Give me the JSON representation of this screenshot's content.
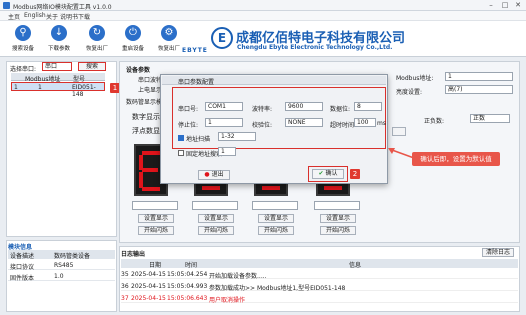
{
  "window": {
    "title": "Modbus网络IO模块配置工具 v1.0.0"
  },
  "menu": [
    "主页",
    "English",
    "关于",
    "说明书下载"
  ],
  "toolbar": {
    "buttons": [
      {
        "label": "搜索设备",
        "icon": "search-icon",
        "color": "#2b6fc9"
      },
      {
        "label": "下载参数",
        "icon": "download-icon",
        "color": "#2b6fc9"
      },
      {
        "label": "恢复出厂",
        "icon": "reset-icon",
        "color": "#2b6fc9"
      },
      {
        "label": "重启设备",
        "icon": "restart-icon",
        "color": "#2b6fc9"
      },
      {
        "label": "恢复出厂",
        "icon": "factory-icon",
        "color": "#2b6fc9"
      }
    ]
  },
  "branding": {
    "logo_letter": "E",
    "logo_text": "EBYTE",
    "company_cn": "成都亿佰特电子科技有限公司",
    "company_en": "Chengdu Ebyte Electronic Technology Co.,Ltd."
  },
  "left": {
    "port_label": "选择串口:",
    "port_value": "串口",
    "search_btn": "搜索",
    "table_headers": [
      "",
      "Modbus地址",
      "型号"
    ],
    "rows": [
      {
        "idx": "1",
        "addr": "1",
        "model": "EID051-148"
      }
    ]
  },
  "status": {
    "title": "模块信息",
    "headers": [
      "设备描述",
      "数码管类设备"
    ],
    "rows": [
      [
        "接口协议",
        "RS485"
      ],
      [
        "固件版本",
        "1.0"
      ]
    ]
  },
  "right": {
    "section_title": "设备参数",
    "fields": [
      {
        "label": "串口波特率",
        "value": ""
      },
      {
        "label": "上电显示方式",
        "value": ""
      }
    ],
    "digits_title": "数码管显示模式",
    "digit_display_label": "数字显示:",
    "float_label": "浮点数显示:",
    "right_label1": "Modbus地址:",
    "right_value1": "1",
    "right_label2": "亮度设置:",
    "right_value2": "高(7)",
    "right_label3": "正负数:",
    "right_value3": "正数",
    "digit_buttons": [
      "设置显示",
      "设置显示",
      "设置显示",
      "设置显示"
    ],
    "digit_buttons2": [
      "开始闪烁",
      "开始闪烁",
      "开始闪烁",
      "开始闪烁"
    ],
    "digit_char": "E"
  },
  "log": {
    "title": "日志输出",
    "clear_btn": "清除日志",
    "headers": [
      "日期",
      "时间",
      "信息"
    ],
    "rows": [
      {
        "idx": "35",
        "date": "2025-04-15",
        "time": "15:05:04.254",
        "msg": "开始加载设备参数.....",
        "color": "#222222"
      },
      {
        "idx": "36",
        "date": "2025-04-15",
        "time": "15:05:04.993",
        "msg": "参数加载成功>> Modbus地址1,型号EID051-148",
        "color": "#222222"
      },
      {
        "idx": "37",
        "date": "2025-04-15",
        "time": "15:05:06.643",
        "msg": "用户取消操作",
        "color": "#e0141b"
      }
    ]
  },
  "dialog": {
    "title": "串口参数配置",
    "port_label": "串口号:",
    "port_value": "COM1",
    "baud_label": "波特率:",
    "baud_value": "9600",
    "data_label": "数据位:",
    "data_value": "8",
    "stop_label": "停止位:",
    "stop_value": "1",
    "check_label": "校验位:",
    "check_value": "NONE",
    "timeout_label": "超时时间:",
    "timeout_value": "100",
    "timeout_unit": "ms",
    "auto_addr_label": "地址扫描",
    "auto_addr_value": "1-32",
    "broadcast_label": "固定地址搜索",
    "broadcast_value": "1",
    "cancel_btn": "退出",
    "ok_btn": "确认"
  },
  "annotations": {
    "badge1": "1",
    "badge2": "2",
    "callout": "确认后即，设置为默认值"
  }
}
